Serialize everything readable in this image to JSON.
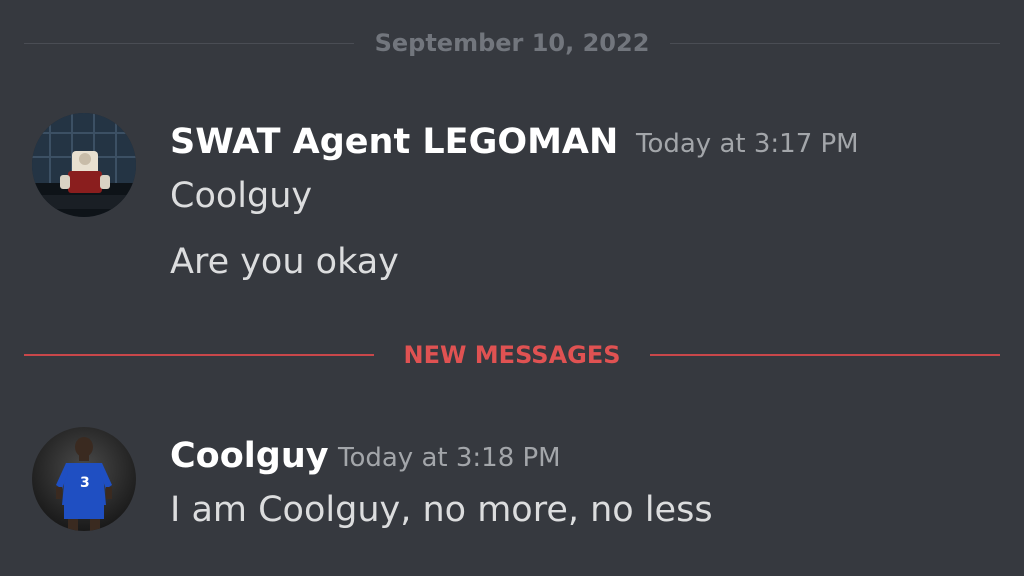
{
  "date_divider": {
    "label": "September 10, 2022"
  },
  "new_messages_divider": {
    "label": "NEW MESSAGES"
  },
  "messages": [
    {
      "username": "SWAT Agent LEGOMAN",
      "timestamp": "Today at 3:17 PM",
      "avatar_icon": "lego-figure-avatar",
      "lines": [
        "Coolguy",
        "Are you okay"
      ]
    },
    {
      "username": "Coolguy",
      "timestamp": "Today at 3:18 PM",
      "avatar_icon": "football-player-avatar",
      "lines": [
        "I am Coolguy, no more, no less"
      ]
    }
  ],
  "colors": {
    "background": "#36393f",
    "username": "#ffffff",
    "message_text": "#dcddde",
    "timestamp": "#a3a6aa",
    "new_messages_accent": "#e05252"
  }
}
